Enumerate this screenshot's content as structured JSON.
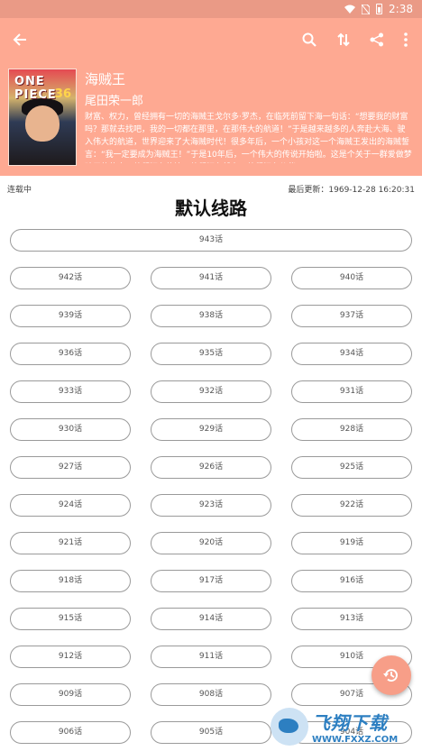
{
  "status_bar": {
    "time": "2:38"
  },
  "manga": {
    "title": "海贼王",
    "author": "尾田荣一郎",
    "cover_text": "ONE PIECE",
    "cover_number": "36",
    "description": "财富、权力，曾经拥有一切的海贼王戈尔多·罗杰，在临死前留下海一句话：“想要我的财富吗？那就去找吧，我的一切都在那里，在那伟大的航道！”于是越来越多的人奔赴大海、驶入伟大的航道，世界迎来了大海贼时代！很多年后，一个小孩对这一个海贼王发出的海贼誓言：“我一定要成为海贼王！”于是10年后，一个伟大的传说开始啦。这是个关于一群爱做梦孩子的故事，他们拥有热情，他们拥有毅力，他们拥有伙伴……",
    "status": "连载中",
    "last_update": "最后更新：1969-12-28 16:20:31"
  },
  "section_title": "默认线路",
  "episodes_first": "943话",
  "episodes": [
    "942话",
    "941话",
    "940话",
    "939话",
    "938话",
    "937话",
    "936话",
    "935话",
    "934话",
    "933话",
    "932话",
    "931话",
    "930话",
    "929话",
    "928话",
    "927话",
    "926话",
    "925话",
    "924话",
    "923话",
    "922话",
    "921话",
    "920话",
    "919话",
    "918话",
    "917话",
    "916话",
    "915话",
    "914话",
    "913话",
    "912话",
    "911话",
    "910话",
    "909话",
    "908话",
    "907话",
    "906话",
    "905话",
    "904话"
  ],
  "watermark": {
    "main": "飞翔下载",
    "sub": "WWW.FXXZ.COM"
  },
  "colors": {
    "toolbar": "#fea992",
    "status_bar": "#ea9a86",
    "fab": "#f79e88"
  }
}
